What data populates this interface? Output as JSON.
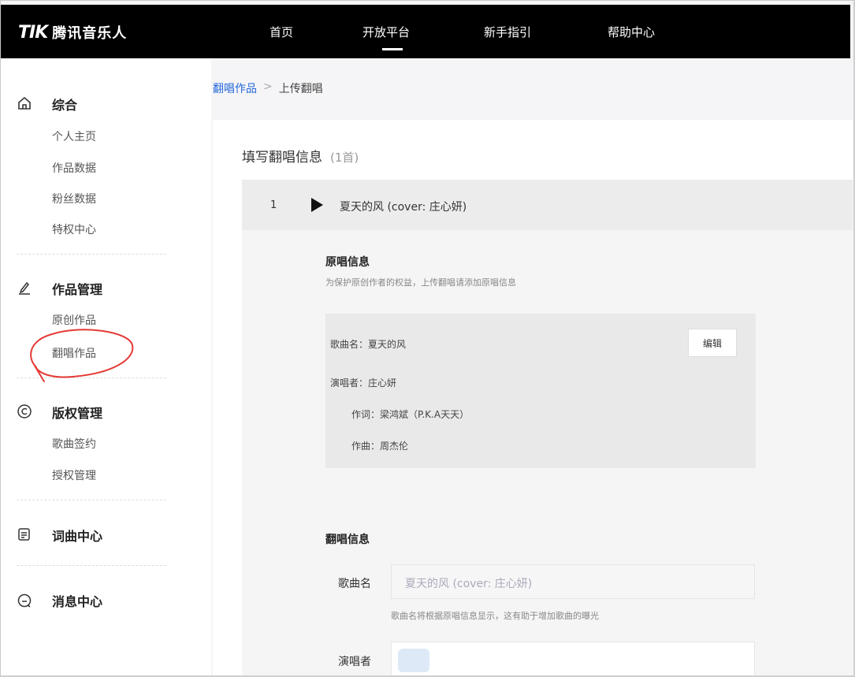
{
  "header": {
    "logo_mark": "TIK",
    "logo_text": "腾讯音乐人",
    "nav": [
      {
        "label": "首页"
      },
      {
        "label": "开放平台",
        "active": true
      },
      {
        "label": "新手指引"
      },
      {
        "label": "帮助中心"
      }
    ]
  },
  "sidebar": {
    "sections": [
      {
        "title": "综合",
        "icon": "home-icon",
        "items": [
          "个人主页",
          "作品数据",
          "粉丝数据",
          "特权中心"
        ]
      },
      {
        "title": "作品管理",
        "icon": "pen-icon",
        "items": [
          "原创作品",
          "翻唱作品"
        ]
      },
      {
        "title": "版权管理",
        "icon": "copyright-icon",
        "items": [
          "歌曲签约",
          "授权管理"
        ]
      },
      {
        "title": "词曲中心",
        "icon": "document-icon",
        "items": []
      },
      {
        "title": "消息中心",
        "icon": "message-icon",
        "items": []
      }
    ]
  },
  "breadcrumb": {
    "link": "翻唱作品",
    "separator": ">",
    "current": "上传翻唱"
  },
  "form": {
    "title": "填写翻唱信息",
    "count": "(1首)",
    "song": {
      "index": "1",
      "name": "夏天的风 (cover: 庄心妍)"
    },
    "original": {
      "heading": "原唱信息",
      "description": "为保护原创作者的权益，上传翻唱请添加原唱信息",
      "rows": [
        "歌曲名：夏天的风",
        "演唱者：庄心妍",
        "作词：梁鸿斌（P.K.A天天）",
        "作曲：周杰伦"
      ],
      "edit_label": "编辑"
    },
    "cover": {
      "heading": "翻唱信息",
      "song_label": "歌曲名",
      "song_value": "夏天的风 (cover: 庄心妍)",
      "song_hint": "歌曲名将根据原唱信息显示，这有助于增加歌曲的曝光",
      "singer_label": "演唱者"
    }
  },
  "colors": {
    "accent": "#2468d9",
    "header_bg": "#000000",
    "annotation": "#e53935"
  }
}
